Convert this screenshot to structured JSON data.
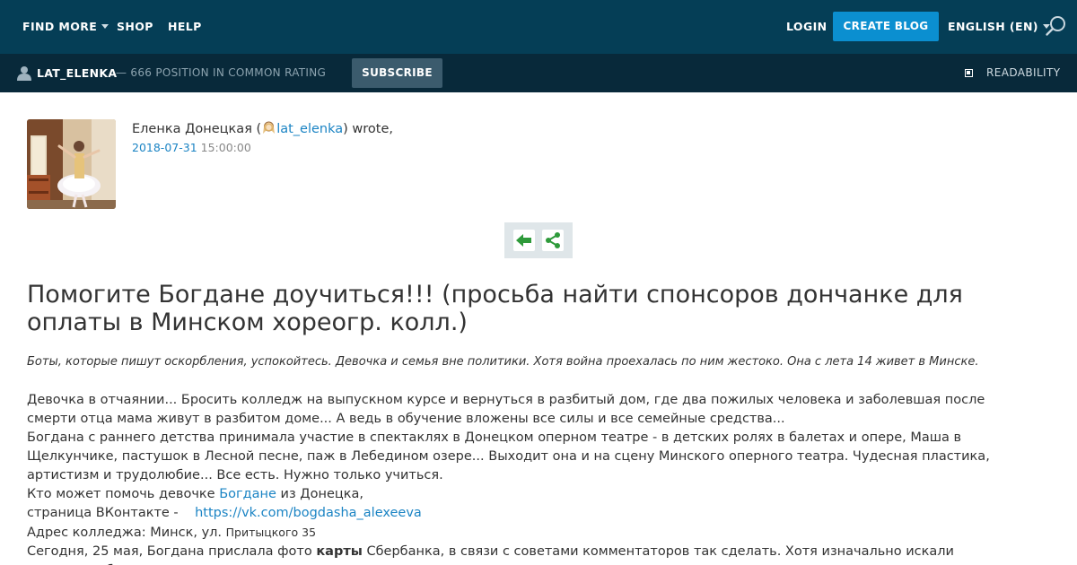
{
  "topnav": {
    "find_more": "FIND MORE",
    "shop": "SHOP",
    "help": "HELP",
    "login": "LOGIN",
    "create_blog": "CREATE BLOG",
    "language": "ENGLISH (EN)",
    "background_color": "#053e56",
    "accent_color": "#0b8fd0"
  },
  "subbar": {
    "username": "LAT_ELENKA",
    "rating_text": "— 666 POSITION IN COMMON RATING",
    "subscribe": "SUBSCRIBE",
    "readability": "READABILITY",
    "background_color": "#08293a"
  },
  "author": {
    "name": "Еленка Донецкая (",
    "handle": "lat_elenka",
    "wrote": ") wrote,",
    "date": "2018-07-31",
    "time": "15:00:00"
  },
  "actions": {
    "back_icon": "arrow-left-icon",
    "share_icon": "share-icon"
  },
  "post": {
    "title": "Помогите Богдане доучиться!!! (просьба найти спонсоров дончанке для оплаты в Минском хореогр. колл.)",
    "intro": "Боты, которые пишут оскорбления, успокойтесь. Девочка и семья вне политики. Хотя война проехалась по ним жестоко. Она с лета 14 живет в Минске.",
    "p1": "Девочка в отчаянии... Бросить колледж на выпускном курсе и вернуться в разбитый дом, где два пожилых человека и заболевшая после смерти отца мама живут в разбитом доме... А ведь в обучение вложены все силы и все семейные средства...",
    "p2": "Богдана с раннего детства принимала участие в спектаклях в Донецком оперном театре -  в детских ролях в балетах и опере, Маша в Щелкунчике, пастушок в Лесной песне, паж в Лебедином озере... Выходит она и на сцену Минского оперного театра. Чудесная пластика, артистизм и трудолюбие... Все есть. Нужно только учиться.",
    "p3_before": "Кто может помочь девочке ",
    "p3_link": "Богдане",
    "p3_after": " из Донецка,",
    "p4_before": "страница ВКонтакте -    ",
    "p4_link": "https://vk.com/bogdasha_alexeeva",
    "p5_before": "Адрес колледжа: Минск, ул. ",
    "p5_small": "Притыцкого 35",
    "p6_before": "Сегодня, 25 мая, Богдана прислала фото ",
    "p6_bold": "карты",
    "p6_after": " Сбербанка, в связи с советами комментаторов так сделать. Хотя изначально искали спонсора, сбор на"
  }
}
